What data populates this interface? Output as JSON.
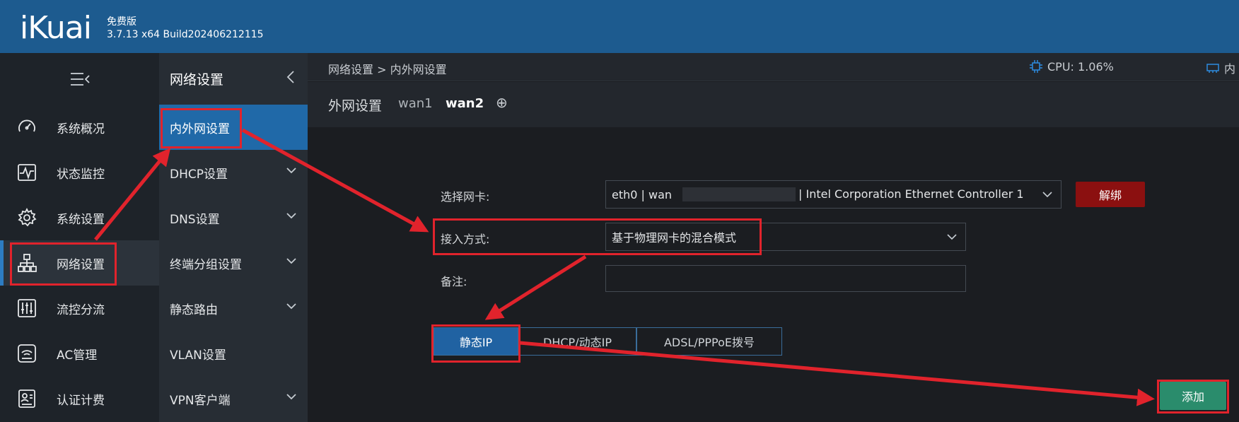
{
  "header": {
    "logo": "iKuai",
    "edition": "免费版",
    "version": "3.7.13 x64 Build202406212115"
  },
  "sidebar": {
    "toggle_icon": "menu-collapse-icon",
    "items": [
      {
        "label": "系统概况",
        "icon": "speedometer-icon"
      },
      {
        "label": "状态监控",
        "icon": "pulse-monitor-icon"
      },
      {
        "label": "系统设置",
        "icon": "gear-icon"
      },
      {
        "label": "网络设置",
        "icon": "network-tree-icon",
        "active": true
      },
      {
        "label": "流控分流",
        "icon": "sliders-icon"
      },
      {
        "label": "AC管理",
        "icon": "wifi-router-icon"
      },
      {
        "label": "认证计费",
        "icon": "id-card-icon"
      }
    ]
  },
  "subnav": {
    "title": "网络设置",
    "items": [
      {
        "label": "内外网设置",
        "active": true
      },
      {
        "label": "DHCP设置"
      },
      {
        "label": "DNS设置"
      },
      {
        "label": "终端分组设置"
      },
      {
        "label": "静态路由"
      },
      {
        "label": "VLAN设置"
      },
      {
        "label": "VPN客户端"
      }
    ]
  },
  "content": {
    "breadcrumb": "网络设置 > 内外网设置",
    "cpu_label": "CPU: 1.06%",
    "mem_label": "内",
    "wan_title": "外网设置",
    "wan_tabs": [
      "wan1",
      "wan2"
    ],
    "wan_add": "⊕",
    "form": {
      "nic_label": "选择网卡:",
      "nic_value_prefix": "eth0 | wan",
      "nic_value_suffix": "| Intel Corporation Ethernet Controller 1",
      "unbind": "解绑",
      "access_label": "接入方式:",
      "access_value": "基于物理网卡的混合模式",
      "remark_label": "备注:",
      "remark_value": ""
    },
    "mode_tabs": [
      "静态IP",
      "DHCP/动态IP",
      "ADSL/PPPoE拨号"
    ],
    "add_button": "添加"
  },
  "colors": {
    "header_bg": "#1d5b8f",
    "highlight": "#e1232c",
    "active_tab": "#2062a2",
    "unbind_btn": "#8b1010",
    "add_btn": "#2a8c6c"
  }
}
